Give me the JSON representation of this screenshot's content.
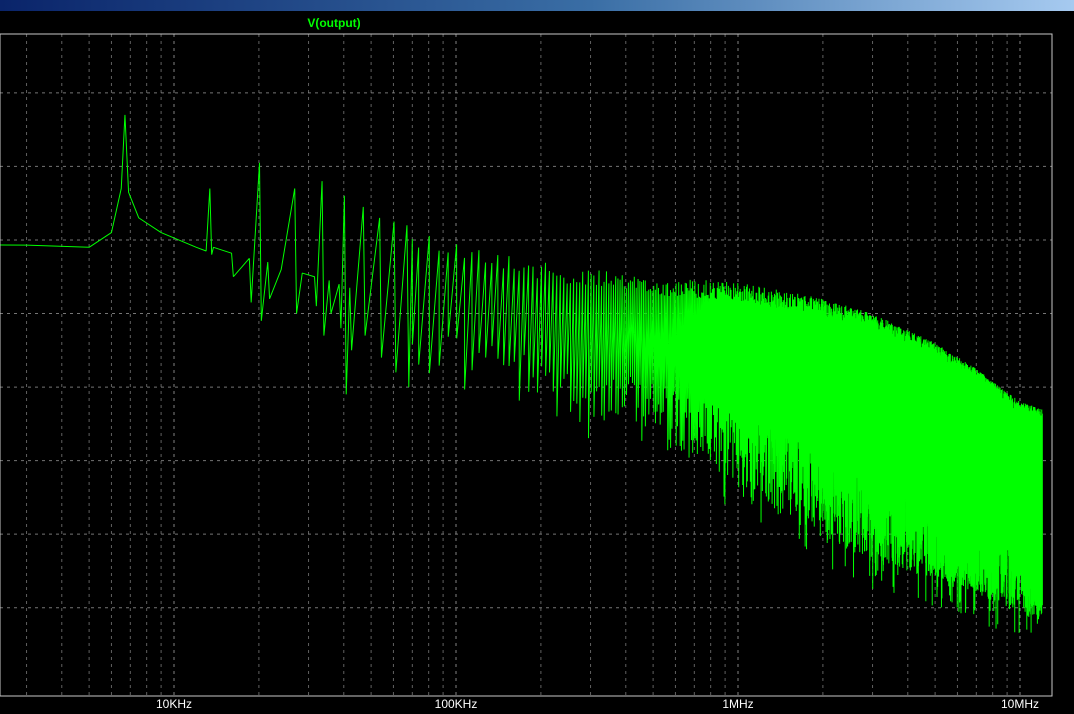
{
  "colors": {
    "background": "#000000",
    "grid": "#8a8a8a",
    "frame": "#c8c8c8",
    "trace": "#00ff00",
    "tick_text": "#ffffff",
    "titlebar_start": "#0a246a",
    "titlebar_end": "#a6caf0"
  },
  "chart_data": {
    "type": "line",
    "title": "V(output)",
    "xlabel": "",
    "ylabel": "",
    "x_scale": "log",
    "x_unit": "Hz",
    "xlim": [
      1000,
      12000000
    ],
    "x_ticks": [
      {
        "value": 10000,
        "label": "10KHz"
      },
      {
        "value": 100000,
        "label": "100KHz"
      },
      {
        "value": 1000000,
        "label": "1MHz"
      },
      {
        "value": 10000000,
        "label": "10MHz"
      }
    ],
    "y_tick_labels": [],
    "grid": true,
    "legend": "none",
    "series": [
      {
        "name": "V(output)",
        "note_peaks_hz": [
          6700,
          13400,
          20100,
          26800,
          33500,
          40200,
          46900,
          53600,
          60300,
          67000
        ],
        "x": [
          1000,
          3000,
          5000,
          6000,
          6500,
          6700,
          6900,
          7500,
          9000,
          12000,
          13000,
          13400,
          13800,
          16000,
          18500,
          20100,
          21500,
          24000,
          26800,
          28500,
          31500,
          33500,
          35500,
          38500,
          40200,
          42000,
          46900,
          53600,
          60300,
          67000,
          80000,
          100000,
          150000,
          200000,
          300000,
          500000,
          800000,
          1000000,
          1500000,
          2000000,
          3000000,
          5000000,
          7000000,
          10000000,
          12000000
        ],
        "upper": [
          -20.6,
          -20.7,
          -21.0,
          -19.0,
          -13.0,
          -3.0,
          -13.5,
          -17.0,
          -19.0,
          -21.0,
          -21.5,
          -13.0,
          -21.0,
          -21.8,
          -22.5,
          -9.5,
          -23.0,
          -24.0,
          -13.0,
          -24.5,
          -25.0,
          -12.0,
          -25.5,
          -26.0,
          -14.0,
          -26.5,
          -15.5,
          -17.0,
          -17.5,
          -18.0,
          -19.0,
          -20.0,
          -21.5,
          -23.0,
          -24.0,
          -25.0,
          -25.5,
          -25.8,
          -27.0,
          -28.0,
          -30.0,
          -34.0,
          -37.5,
          -42.0,
          -43.0
        ],
        "lower": [
          -20.6,
          -20.7,
          -21.0,
          -21.0,
          -21.5,
          -22.0,
          -22.0,
          -22.0,
          -22.0,
          -22.0,
          -22.0,
          -22.0,
          -22.0,
          -25.0,
          -28.5,
          -31.0,
          -28.0,
          -26.5,
          -30.0,
          -27.5,
          -29.0,
          -33.0,
          -30.0,
          -32.0,
          -41.0,
          -35.0,
          -33.0,
          -36.0,
          -38.0,
          -40.0,
          -39.0,
          -39.0,
          -41.0,
          -44.0,
          -45.0,
          -48.0,
          -52.0,
          -55.0,
          -58.0,
          -61.0,
          -64.0,
          -66.0,
          -68.0,
          -71.0,
          -72.0
        ]
      }
    ]
  }
}
